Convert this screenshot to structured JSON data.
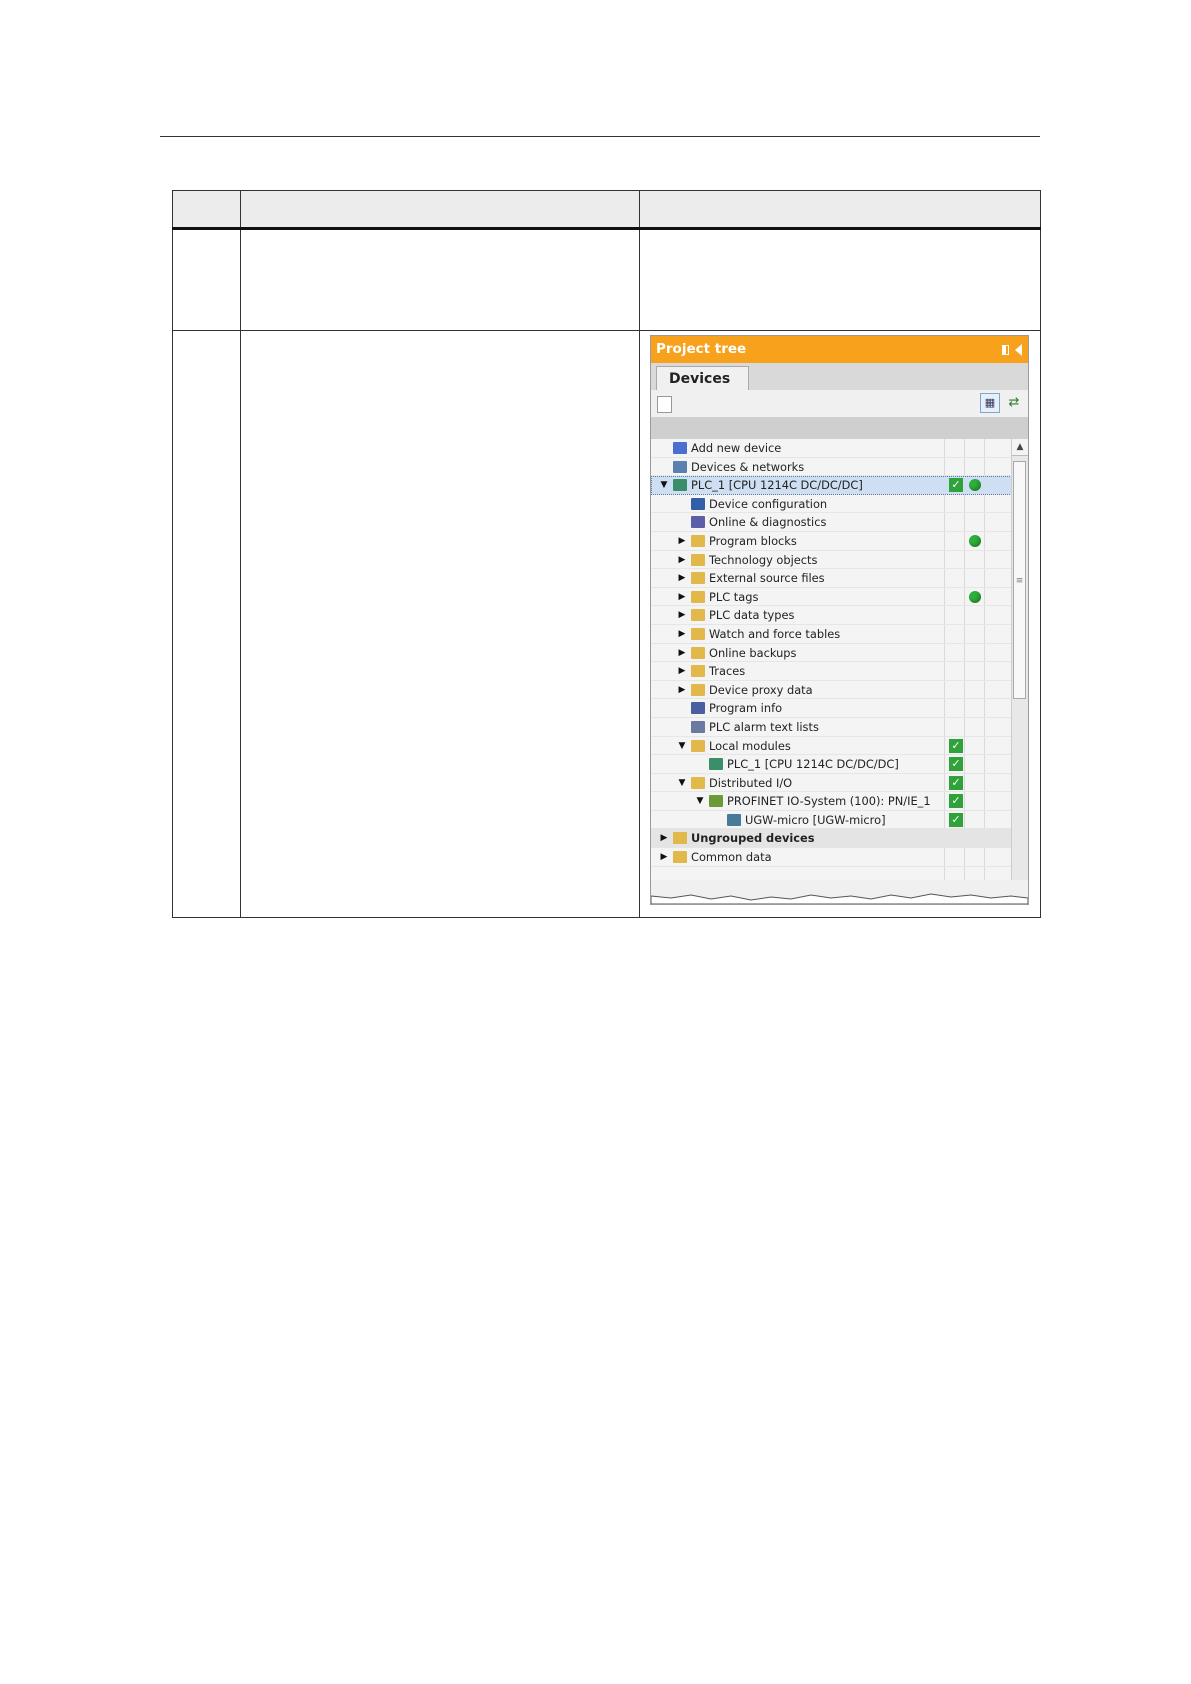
{
  "project_tree": {
    "title": "Project tree",
    "tab": "Devices",
    "items": [
      {
        "label": "Add new device",
        "level": 0,
        "caret": "",
        "icon": "add-device-icon",
        "color": "#4a6fd1",
        "check": false,
        "dot": false
      },
      {
        "label": "Devices & networks",
        "level": 0,
        "caret": "",
        "icon": "network-icon",
        "color": "#5a7fb0",
        "check": false,
        "dot": false
      },
      {
        "label": "PLC_1 [CPU 1214C DC/DC/DC]",
        "level": 0,
        "caret": "down",
        "icon": "plc-icon",
        "color": "#3a8f6a",
        "check": true,
        "dot": true,
        "selected": true
      },
      {
        "label": "Device configuration",
        "level": 1,
        "caret": "",
        "icon": "device-config-icon",
        "color": "#335fa8",
        "check": false,
        "dot": false
      },
      {
        "label": "Online & diagnostics",
        "level": 1,
        "caret": "",
        "icon": "diagnostics-icon",
        "color": "#5a5fa8",
        "check": false,
        "dot": false
      },
      {
        "label": "Program blocks",
        "level": 1,
        "caret": "right",
        "icon": "folder-icon",
        "color": "#e2b84a",
        "check": false,
        "dot": true
      },
      {
        "label": "Technology objects",
        "level": 1,
        "caret": "right",
        "icon": "folder-icon",
        "color": "#e2b84a",
        "check": false,
        "dot": false
      },
      {
        "label": "External source files",
        "level": 1,
        "caret": "right",
        "icon": "folder-icon",
        "color": "#e2b84a",
        "check": false,
        "dot": false
      },
      {
        "label": "PLC tags",
        "level": 1,
        "caret": "right",
        "icon": "folder-icon",
        "color": "#e2b84a",
        "check": false,
        "dot": true
      },
      {
        "label": "PLC data types",
        "level": 1,
        "caret": "right",
        "icon": "folder-icon",
        "color": "#e2b84a",
        "check": false,
        "dot": false
      },
      {
        "label": "Watch and force tables",
        "level": 1,
        "caret": "right",
        "icon": "folder-icon",
        "color": "#e2b84a",
        "check": false,
        "dot": false
      },
      {
        "label": "Online backups",
        "level": 1,
        "caret": "right",
        "icon": "folder-icon",
        "color": "#e2b84a",
        "check": false,
        "dot": false
      },
      {
        "label": "Traces",
        "level": 1,
        "caret": "right",
        "icon": "folder-icon",
        "color": "#e2b84a",
        "check": false,
        "dot": false
      },
      {
        "label": "Device proxy data",
        "level": 1,
        "caret": "right",
        "icon": "folder-icon",
        "color": "#e2b84a",
        "check": false,
        "dot": false
      },
      {
        "label": "Program info",
        "level": 1,
        "caret": "",
        "icon": "program-info-icon",
        "color": "#4a5fa0",
        "check": false,
        "dot": false
      },
      {
        "label": "PLC alarm text lists",
        "level": 1,
        "caret": "",
        "icon": "text-list-icon",
        "color": "#6a7aa0",
        "check": false,
        "dot": false
      },
      {
        "label": "Local modules",
        "level": 1,
        "caret": "down",
        "icon": "folder-icon",
        "color": "#e2b84a",
        "check": true,
        "dot": false
      },
      {
        "label": "PLC_1 [CPU 1214C DC/DC/DC]",
        "level": 2,
        "caret": "",
        "icon": "plc-icon",
        "color": "#3a8f6a",
        "check": true,
        "dot": false
      },
      {
        "label": "Distributed I/O",
        "level": 1,
        "caret": "down",
        "icon": "folder-icon",
        "color": "#e2b84a",
        "check": true,
        "dot": false
      },
      {
        "label": "PROFINET IO-System (100): PN/IE_1",
        "level": 2,
        "caret": "down",
        "icon": "profinet-icon",
        "color": "#6a9a3a",
        "check": true,
        "dot": false
      },
      {
        "label": "UGW-micro [UGW-micro]",
        "level": 3,
        "caret": "",
        "icon": "io-device-icon",
        "color": "#4a7a9a",
        "check": true,
        "dot": false
      },
      {
        "label": "Ungrouped devices",
        "level": 0,
        "caret": "right",
        "icon": "folder-icon",
        "color": "#e2b84a",
        "check": false,
        "dot": false,
        "group": true
      },
      {
        "label": "Common data",
        "level": 0,
        "caret": "right",
        "icon": "folder-icon",
        "color": "#e2b84a",
        "check": false,
        "dot": false
      }
    ]
  },
  "colors": {
    "title_bar": "#f7a11c",
    "check": "#2fa33a",
    "dot": "#2eae3a"
  }
}
